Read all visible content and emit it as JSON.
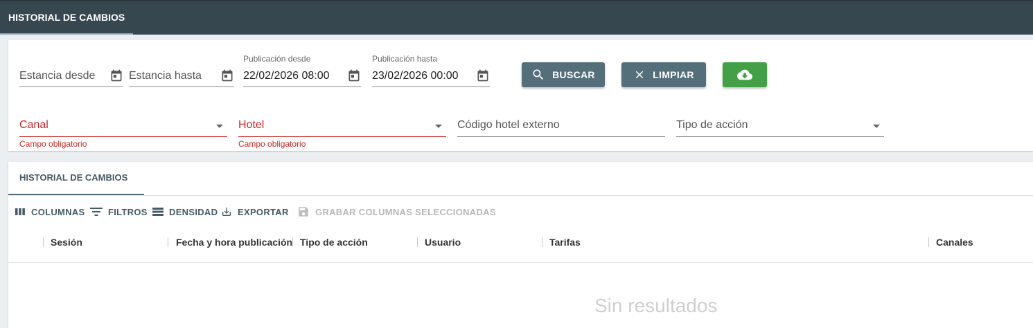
{
  "header": {
    "tab_label": "HISTORIAL DE CAMBIOS"
  },
  "filters": {
    "estancia_desde": {
      "placeholder": "Estancia desde"
    },
    "estancia_hasta": {
      "placeholder": "Estancia hasta"
    },
    "publicacion_desde": {
      "label": "Publicación desde",
      "value": "22/02/2026 08:00"
    },
    "publicacion_hasta": {
      "label": "Publicación hasta",
      "value": "23/02/2026 00:00"
    },
    "canal": {
      "placeholder": "Canal",
      "helper": "Campo obligatorio"
    },
    "hotel": {
      "placeholder": "Hotel",
      "helper": "Campo obligatorio"
    },
    "codigo_hotel": {
      "placeholder": "Código hotel externo"
    },
    "tipo_accion": {
      "placeholder": "Tipo de acción"
    }
  },
  "buttons": {
    "buscar": "BUSCAR",
    "limpiar": "LIMPIAR",
    "download_icon": "cloud-download-icon"
  },
  "colors": {
    "header_bg": "#37474f",
    "button_primary": "#546e7a",
    "button_success": "#43a047",
    "error": "#c62828"
  },
  "results": {
    "tab_label": "HISTORIAL DE CAMBIOS",
    "toolbar": {
      "columnas": "COLUMNAS",
      "filtros": "FILTROS",
      "densidad": "DENSIDAD",
      "exportar": "EXPORTAR",
      "grabar": "GRABAR COLUMNAS SELECCIONADAS"
    },
    "columns": [
      "Sesión",
      "Fecha y hora publicación",
      "Tipo de acción",
      "Usuario",
      "Tarifas",
      "Canales"
    ],
    "empty_text": "Sin resultados"
  }
}
